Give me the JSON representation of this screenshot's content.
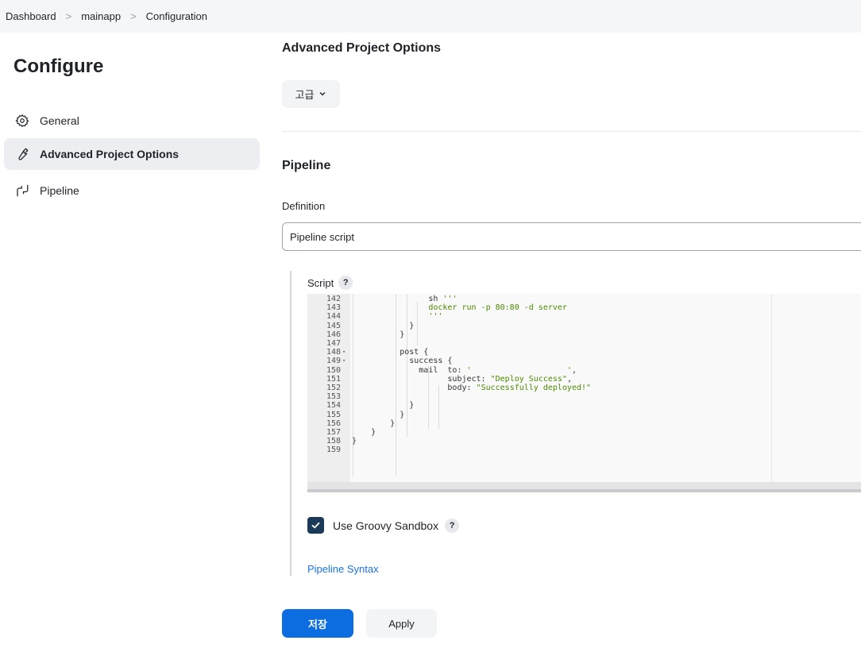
{
  "breadcrumb": {
    "items": [
      "Dashboard",
      "mainapp",
      "Configuration"
    ],
    "separator": ">"
  },
  "sidebar": {
    "title": "Configure",
    "items": [
      {
        "label": "General",
        "icon": "gear-icon",
        "active": false
      },
      {
        "label": "Advanced Project Options",
        "icon": "wrench-icon",
        "active": true
      },
      {
        "label": "Pipeline",
        "icon": "pipeline-icon",
        "active": false
      }
    ]
  },
  "advanced": {
    "heading": "Advanced Project Options",
    "button_label": "고급"
  },
  "pipeline": {
    "heading": "Pipeline",
    "definition_label": "Definition",
    "definition_value": "Pipeline script",
    "script_label": "Script",
    "help_glyph": "?",
    "code_lines": [
      {
        "n": "142",
        "fold": "",
        "text": "                sh '''"
      },
      {
        "n": "143",
        "fold": "",
        "text": "                docker run -p 80:80 -d server",
        "str": true
      },
      {
        "n": "144",
        "fold": "",
        "text": "                '''",
        "str": true
      },
      {
        "n": "145",
        "fold": "",
        "text": "            }"
      },
      {
        "n": "146",
        "fold": "",
        "text": "          }"
      },
      {
        "n": "147",
        "fold": "",
        "text": ""
      },
      {
        "n": "148",
        "fold": "▾",
        "text": "          post {"
      },
      {
        "n": "149",
        "fold": "▾",
        "text": "            success {"
      },
      {
        "n": "150",
        "fold": "",
        "text": "              mail  to: '                    ',"
      },
      {
        "n": "151",
        "fold": "",
        "text": "                    subject: \"Deploy Success\","
      },
      {
        "n": "152",
        "fold": "",
        "text": "                    body: \"Successfully deployed!\""
      },
      {
        "n": "153",
        "fold": "",
        "text": ""
      },
      {
        "n": "154",
        "fold": "",
        "text": "            }"
      },
      {
        "n": "155",
        "fold": "",
        "text": "          }"
      },
      {
        "n": "156",
        "fold": "",
        "text": "        }"
      },
      {
        "n": "157",
        "fold": "",
        "text": "    }"
      },
      {
        "n": "158",
        "fold": "",
        "text": "}"
      },
      {
        "n": "159",
        "fold": "",
        "text": ""
      }
    ],
    "sandbox_label": "Use Groovy Sandbox",
    "sandbox_checked": true,
    "syntax_link": "Pipeline Syntax"
  },
  "actions": {
    "save_label": "저장",
    "apply_label": "Apply"
  },
  "colors": {
    "primary": "#0b6de0",
    "checkbox": "#1b3a57",
    "link": "#1a73e8",
    "string": "#4c8a00"
  }
}
